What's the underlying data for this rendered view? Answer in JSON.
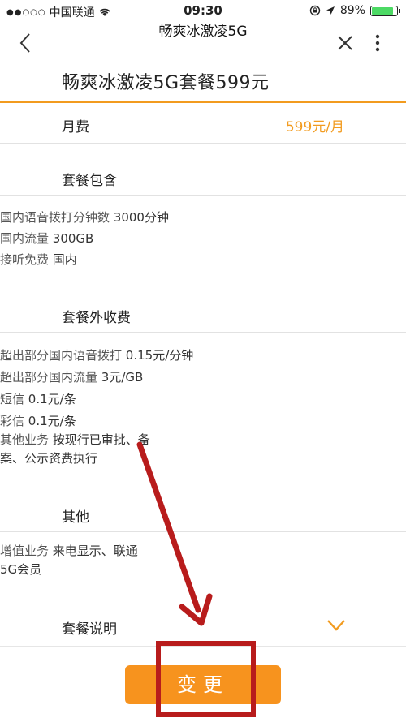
{
  "status_bar": {
    "carrier": "中国联通",
    "time": "09:30",
    "battery": "89%",
    "battery_level": 0.89
  },
  "nav": {
    "title": "畅爽冰激凌5G"
  },
  "plan": {
    "title": "畅爽冰激凌5G套餐599元"
  },
  "fee": {
    "label": "月费",
    "value": "599元/月"
  },
  "included": {
    "title": "套餐包含",
    "items": [
      {
        "label": "国内语音拨打分钟数",
        "value": "3000分钟"
      },
      {
        "label": "国内流量",
        "value": "300GB"
      },
      {
        "label": "接听免费",
        "value": "国内"
      }
    ]
  },
  "extra": {
    "title": "套餐外收费",
    "items": [
      {
        "label": "超出部分国内语音拨打",
        "value": "0.15元/分钟"
      },
      {
        "label": "超出部分国内流量",
        "value": "3元/GB"
      },
      {
        "label": "短信",
        "value": "0.1元/条"
      },
      {
        "label": "彩信",
        "value": "0.1元/条"
      },
      {
        "label": "其他业务",
        "value_line1": "按现行已审批、备",
        "value_line2": "案、公示资费执行"
      }
    ]
  },
  "other": {
    "title": "其他",
    "items": [
      {
        "label": "增值业务",
        "value_line1": "来电显示、联通",
        "value_line2": "5G会员"
      }
    ]
  },
  "description": {
    "title": "套餐说明"
  },
  "action": {
    "change_label": "变更"
  },
  "colors": {
    "accent": "#f7931e",
    "annotation": "#b81c1c"
  },
  "icons": [
    "back-arrow-icon",
    "close-icon",
    "more-vertical-icon",
    "chevron-down-icon",
    "wifi-icon",
    "location-arrow-icon",
    "rotation-lock-icon",
    "battery-icon"
  ]
}
